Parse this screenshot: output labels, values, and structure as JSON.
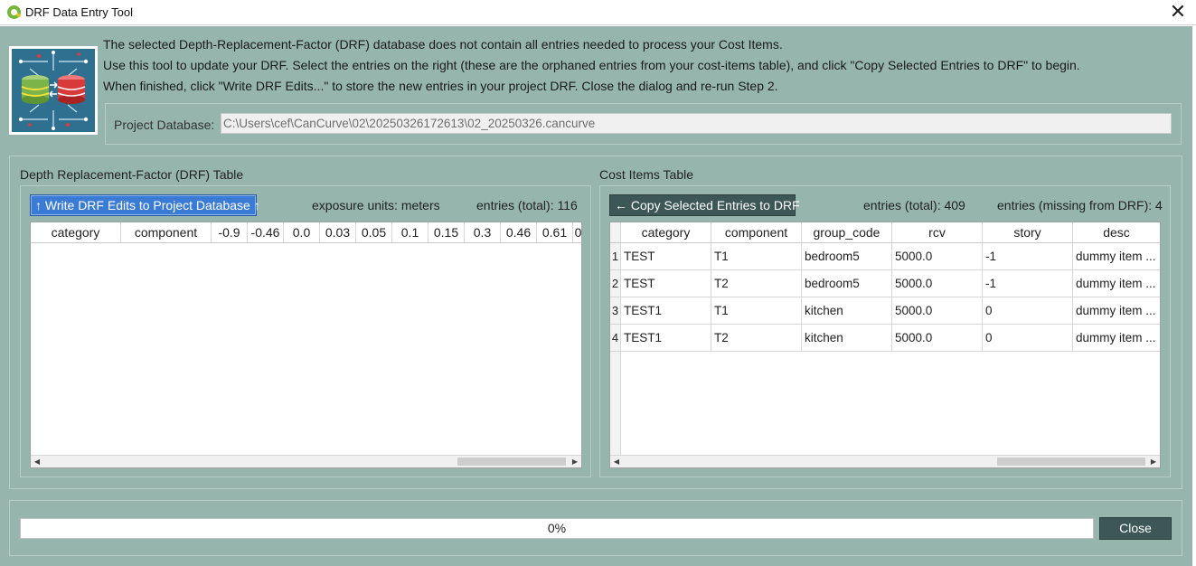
{
  "window": {
    "title": "DRF Data Entry Tool",
    "close_glyph": "✕"
  },
  "intro": {
    "line1": "The selected Depth-Replacement-Factor (DRF) database does not contain all entries needed to process your Cost Items.",
    "line2": "Use this tool to update your DRF. Select the entries on the right (these are the orphaned entries from your cost-items table), and click \"Copy Selected Entries to DRF\" to begin.",
    "line3": "When finished, click \"Write DRF Edits...\" to store the new entries in your project DRF. Close the dialog and re-run Step 2."
  },
  "project": {
    "label": "Project Database:",
    "path": "C:\\Users\\cef\\CanCurve\\02\\20250326172613\\02_20250326.cancurve"
  },
  "drf": {
    "title": "Depth Replacement-Factor (DRF) Table",
    "write_button": "↑ Write DRF Edits to Project Database ↑",
    "exposure_label": "exposure units:",
    "exposure_value": "meters",
    "entries_label": "entries (total):",
    "entries_value": "116",
    "columns": [
      "category",
      "component",
      "-0.9",
      "-0.46",
      "0.0",
      "0.03",
      "0.05",
      "0.1",
      "0.15",
      "0.3",
      "0.46",
      "0.61",
      "0"
    ]
  },
  "cost": {
    "title": "Cost Items Table",
    "copy_button": "← Copy Selected Entries to DRF",
    "entries_label": "entries (total):",
    "entries_value": "409",
    "missing_label": "entries (missing from DRF):",
    "missing_value": "4",
    "columns": [
      "category",
      "component",
      "group_code",
      "rcv",
      "story",
      "desc"
    ],
    "rows": [
      {
        "n": "1",
        "cells": [
          "TEST",
          "T1",
          "bedroom5",
          "5000.0",
          "-1",
          "dummy item ..."
        ]
      },
      {
        "n": "2",
        "cells": [
          "TEST",
          "T2",
          "bedroom5",
          "5000.0",
          "-1",
          "dummy item ..."
        ]
      },
      {
        "n": "3",
        "cells": [
          "TEST1",
          "T1",
          "kitchen",
          "5000.0",
          "0",
          "dummy item ..."
        ]
      },
      {
        "n": "4",
        "cells": [
          "TEST1",
          "T2",
          "kitchen",
          "5000.0",
          "0",
          "dummy item ..."
        ]
      }
    ]
  },
  "footer": {
    "progress_text": "0%",
    "progress_value": 0,
    "close_button": "Close"
  },
  "colors": {
    "dialog_bg": "#96b5ad",
    "accent_blue": "#3a7bd5",
    "dark_button": "#3d5756"
  },
  "icons": {
    "app": "qgis-logo-icon",
    "logo": "database-sync-logo",
    "close": "close-icon"
  }
}
